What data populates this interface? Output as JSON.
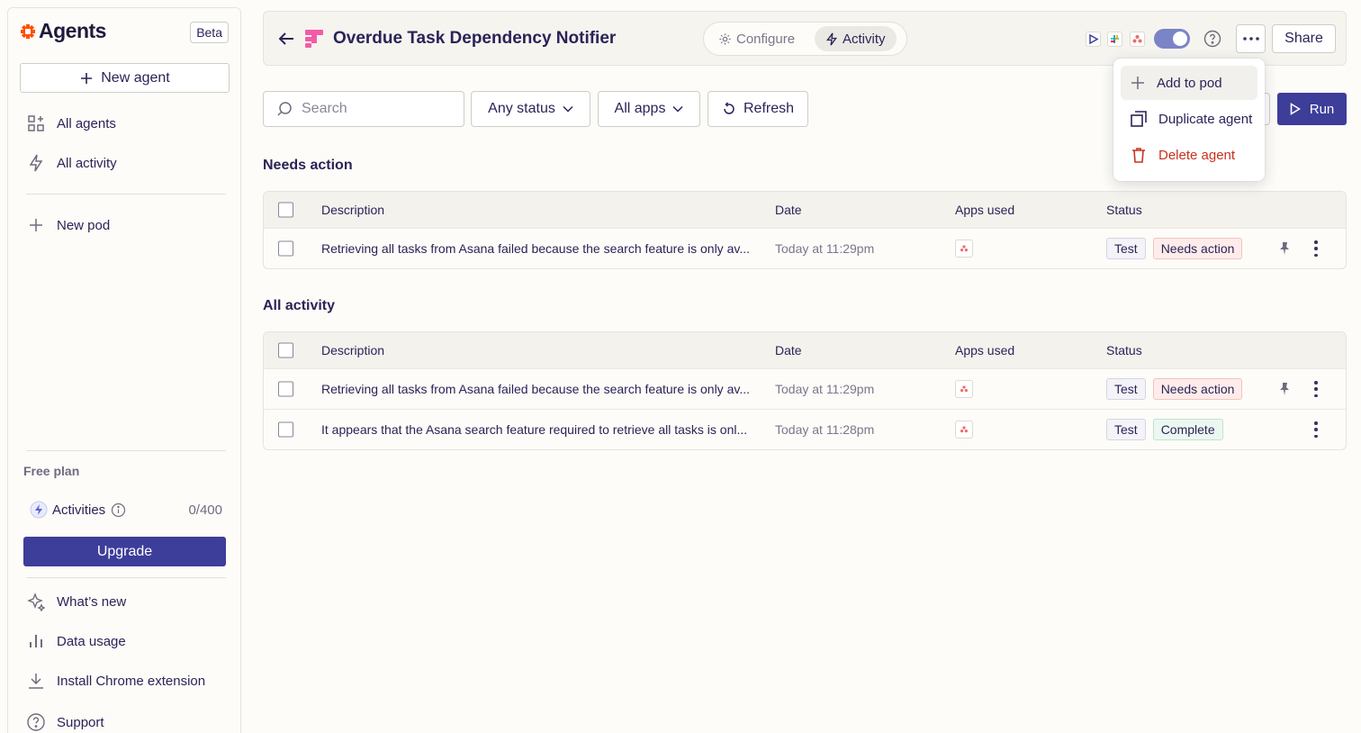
{
  "sidebar": {
    "logo_text": "Agents",
    "beta": "Beta",
    "new_agent": "New agent",
    "nav": {
      "all_agents": "All agents",
      "all_activity": "All activity",
      "new_pod": "New pod"
    },
    "plan": {
      "label": "Free plan",
      "activities_label": "Activities",
      "activities_count": "0/400",
      "upgrade": "Upgrade"
    },
    "footer": {
      "whats_new": "What’s new",
      "data_usage": "Data usage",
      "chrome_ext": "Install Chrome extension",
      "support": "Support"
    }
  },
  "header": {
    "title": "Overdue Task Dependency Notifier",
    "tabs": {
      "configure": "Configure",
      "activity": "Activity"
    },
    "share": "Share",
    "toggle_on": true
  },
  "filters": {
    "search_placeholder": "Search",
    "status": "Any status",
    "apps": "All apps",
    "refresh": "Refresh",
    "run": "Run"
  },
  "menu": {
    "add_to_pod": "Add to pod",
    "duplicate": "Duplicate agent",
    "delete": "Delete agent"
  },
  "columns": {
    "description": "Description",
    "date": "Date",
    "apps": "Apps used",
    "status": "Status"
  },
  "needs_action": {
    "title": "Needs action",
    "rows": [
      {
        "description": "Retrieving all tasks from Asana failed because the search feature is only av...",
        "date": "Today at 11:29pm",
        "tag": "Test",
        "status": "Needs action"
      }
    ]
  },
  "all_activity": {
    "title": "All activity",
    "rows": [
      {
        "description": "Retrieving all tasks from Asana failed because the search feature is only av...",
        "date": "Today at 11:29pm",
        "tag": "Test",
        "status": "Needs action"
      },
      {
        "description": "It appears that the Asana search feature required to retrieve all tasks is onl...",
        "date": "Today at 11:28pm",
        "tag": "Test",
        "status": "Complete"
      }
    ]
  },
  "colors": {
    "accent": "#3d3d9a",
    "brand": "#ff4f00",
    "danger": "#c8321f",
    "toggle": "#7a84c6"
  }
}
